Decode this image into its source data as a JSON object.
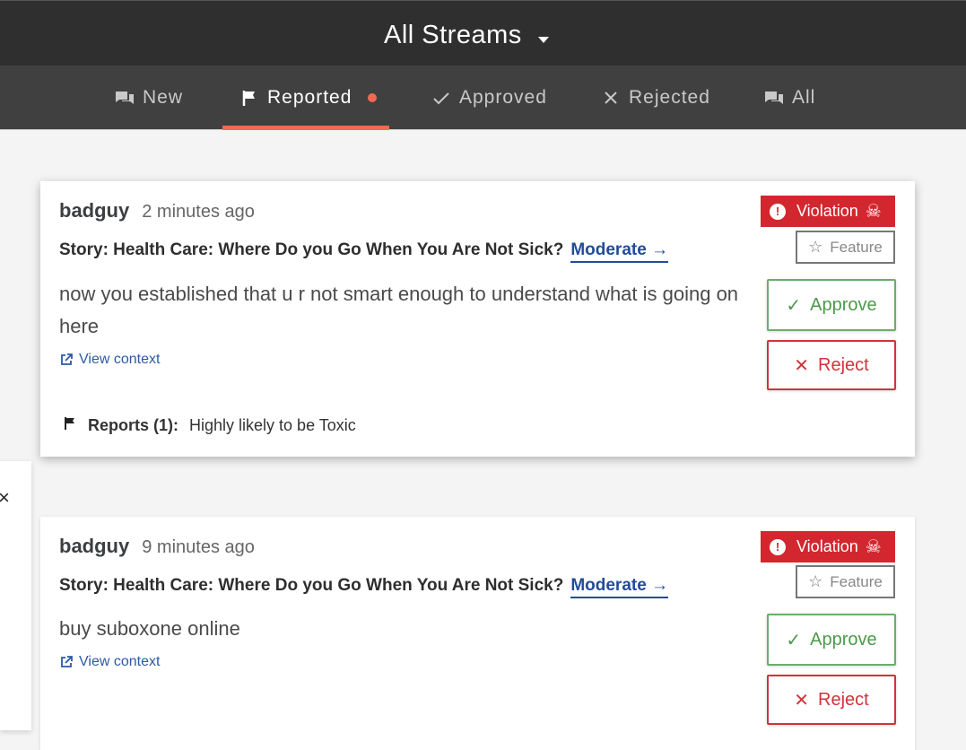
{
  "header": {
    "stream_title": "All Streams"
  },
  "tabs": [
    {
      "label": "New"
    },
    {
      "label": "Reported"
    },
    {
      "label": "Approved"
    },
    {
      "label": "Rejected"
    },
    {
      "label": "All"
    }
  ],
  "close_panel": {
    "symbol": "×"
  },
  "comments": [
    {
      "username": "badguy",
      "time": "2 minutes ago",
      "story": "Story: Health Care: Where Do you Go When You Are Not Sick?",
      "moderate": "Moderate →",
      "body": "now you established that u r not smart enough to understand what is going on here",
      "view_context": "View context",
      "reports_label": "Reports (1):",
      "reports_text": "Highly likely to be Toxic",
      "violation": "Violation",
      "feature": "Feature",
      "approve": "Approve",
      "reject": "Reject"
    },
    {
      "username": "badguy",
      "time": "9 minutes ago",
      "story": "Story: Health Care: Where Do you Go When You Are Not Sick?",
      "moderate": "Moderate →",
      "body": "buy suboxone online",
      "view_context": "View context",
      "violation": "Violation",
      "feature": "Feature",
      "approve": "Approve",
      "reject": "Reject"
    }
  ],
  "colors": {
    "header_bg": "#2f2f2f",
    "tabs_bg": "#404040",
    "accent": "#ef6a53",
    "violation": "#d3272f",
    "approve": "#4b9a4b",
    "reject": "#d0343a",
    "link": "#234c98"
  },
  "icons": {
    "new": "chat-bubbles-icon",
    "reported": "flag-icon",
    "approved": "check-icon",
    "rejected": "x-icon",
    "all": "chat-bubbles-icon"
  }
}
